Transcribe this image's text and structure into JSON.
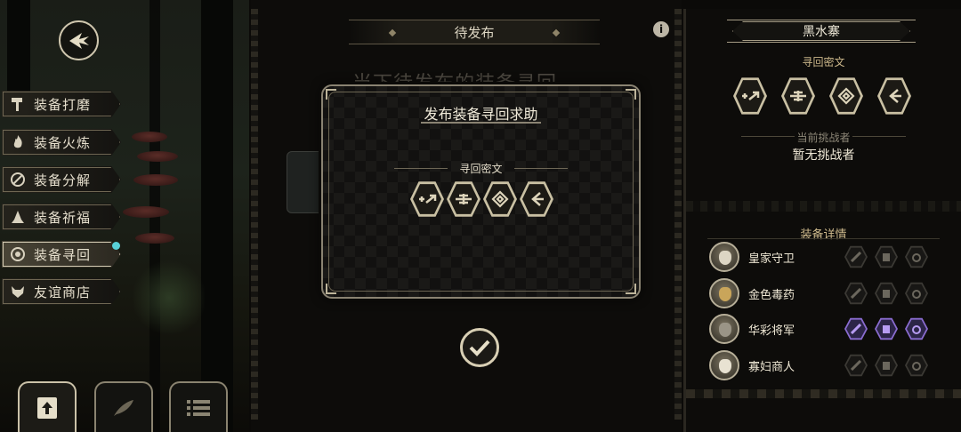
{
  "left_menu": {
    "items": [
      {
        "label": "装备打磨",
        "icon": "hammer-icon"
      },
      {
        "label": "装备火炼",
        "icon": "flame-icon"
      },
      {
        "label": "装备分解",
        "icon": "disassemble-icon"
      },
      {
        "label": "装备祈福",
        "icon": "prayer-hands-icon"
      },
      {
        "label": "装备寻回",
        "icon": "target-icon",
        "active": true
      },
      {
        "label": "友谊商店",
        "icon": "fox-icon"
      }
    ]
  },
  "bottom_tabs": [
    {
      "icon": "upload-icon",
      "active": true
    },
    {
      "icon": "feather-icon",
      "active": false
    },
    {
      "icon": "list-icon",
      "active": false
    }
  ],
  "center": {
    "header": "待发布",
    "background_title": "当下待发布的装备寻回"
  },
  "dialog": {
    "title": "发布装备寻回求助",
    "subtitle": "寻回密文",
    "runes": [
      "rune-1-icon",
      "rune-2-icon",
      "rune-3-icon",
      "rune-4-icon"
    ]
  },
  "right_panel": {
    "location": "黑水寨",
    "cipher_label": "寻回密文",
    "challenger_label": "当前挑战者",
    "challenger_value": "暂无挑战者",
    "details_label": "装备详情",
    "characters": [
      {
        "name": "皇家守卫",
        "lit": false
      },
      {
        "name": "金色毒药",
        "lit": false
      },
      {
        "name": "华彩将军",
        "lit": true
      },
      {
        "name": "寡妇商人",
        "lit": false
      }
    ]
  },
  "colors": {
    "accent_gold": "#cdb98c",
    "rune_border": "#c9c0a3",
    "highlight_purple": "#8a6cd0",
    "notification_dot": "#58d0d8"
  }
}
